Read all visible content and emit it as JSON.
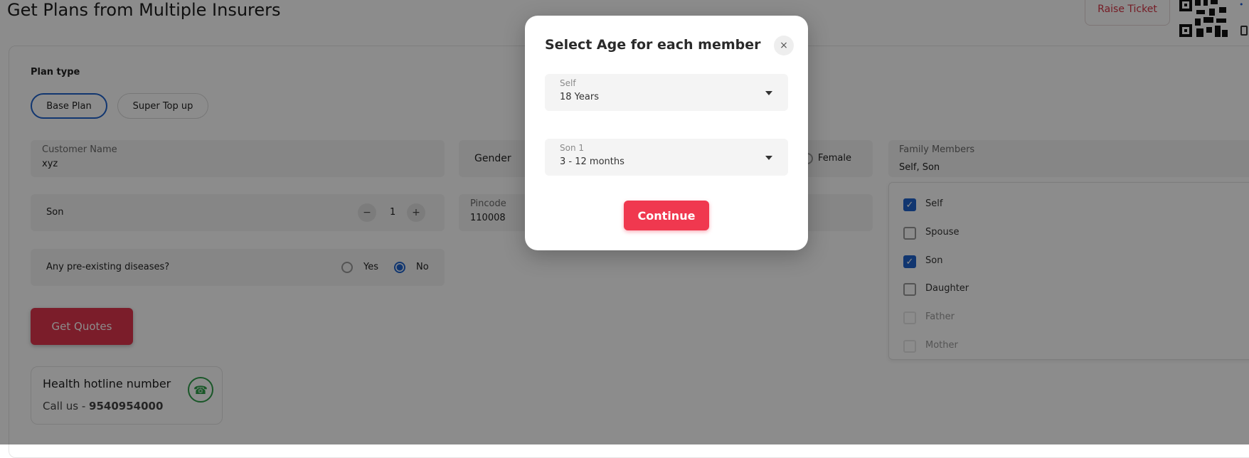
{
  "header": {
    "title": "Get Plans from Multiple Insurers",
    "raise_ticket": "Raise Ticket"
  },
  "form": {
    "plan_type_label": "Plan type",
    "plan_types": [
      "Base Plan",
      "Super Top up"
    ],
    "selected_plan_type": "Base Plan",
    "customer_name_label": "Customer Name",
    "customer_name_value": "xyz",
    "gender_label": "Gender",
    "gender_female": "Female",
    "family_members_label": "Family Members",
    "family_members_value": "Self, Son",
    "son_label": "Son",
    "son_count": "1",
    "minus": "−",
    "plus": "+",
    "pincode_label": "Pincode",
    "pincode_value": "110008",
    "preexisting_label": "Any pre-existing diseases?",
    "yes_label": "Yes",
    "no_label": "No",
    "preexisting_selected": "No",
    "get_quotes": "Get Quotes"
  },
  "hotline": {
    "title": "Health hotline number",
    "call_prefix": "Call us - ",
    "number": "9540954000"
  },
  "family_dropdown": {
    "options": [
      {
        "label": "Self",
        "checked": true
      },
      {
        "label": "Spouse",
        "checked": false
      },
      {
        "label": "Son",
        "checked": true
      },
      {
        "label": "Daughter",
        "checked": false
      },
      {
        "label": "Father",
        "checked": false
      },
      {
        "label": "Mother",
        "checked": false
      }
    ]
  },
  "modal": {
    "title": "Select Age for each member",
    "close_symbol": "×",
    "members": [
      {
        "label": "Self",
        "value": "18 Years"
      },
      {
        "label": "Son 1",
        "value": "3 - 12 months"
      }
    ],
    "continue": "Continue"
  },
  "colors": {
    "accent_red": "#f0384f",
    "accent_blue": "#1f63cc"
  }
}
